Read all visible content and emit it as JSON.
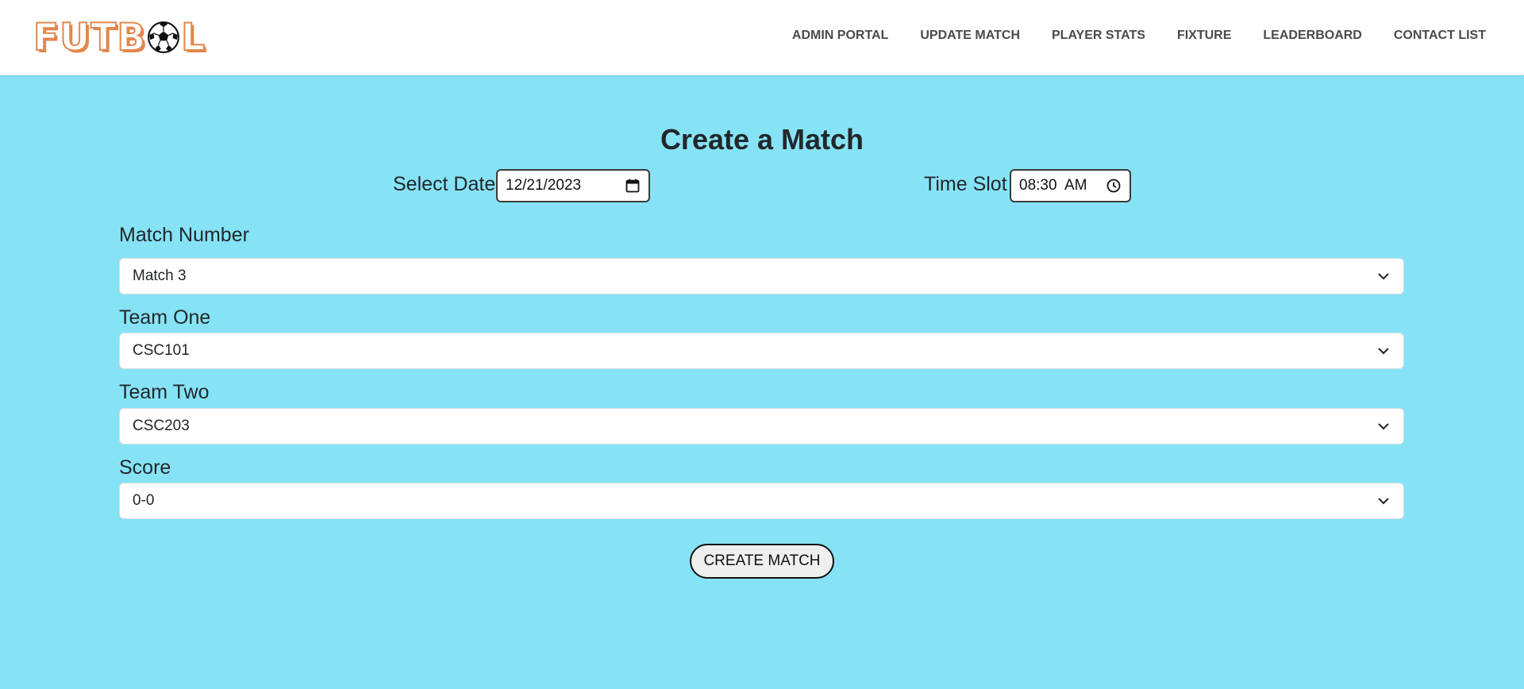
{
  "brand": {
    "logo_text_left": "FUTB",
    "logo_text_right": "L",
    "ball_icon": "soccer-ball-icon",
    "colors": {
      "logo": "#e2874b"
    }
  },
  "nav": {
    "items": [
      {
        "label": "ADMIN PORTAL"
      },
      {
        "label": "UPDATE MATCH"
      },
      {
        "label": "PLAYER STATS"
      },
      {
        "label": "FIXTURE"
      },
      {
        "label": "LEADERBOARD"
      },
      {
        "label": "CONTACT LIST"
      }
    ]
  },
  "form": {
    "title": "Create a Match",
    "date": {
      "label": "Select Date",
      "value": "12/21/2023",
      "icon": "calendar-icon"
    },
    "time": {
      "label": "Time Slot",
      "value": "08:30  AM",
      "icon": "clock-icon"
    },
    "match_number": {
      "label": "Match Number",
      "value": "Match 3"
    },
    "team_one": {
      "label": "Team One",
      "value": "CSC101"
    },
    "team_two": {
      "label": "Team Two",
      "value": "CSC203"
    },
    "score": {
      "label": "Score",
      "value": "0-0"
    },
    "submit_label": "CREATE MATCH"
  },
  "colors": {
    "background": "#86e3f6",
    "navbar": "#ffffff",
    "text": "#212529"
  }
}
